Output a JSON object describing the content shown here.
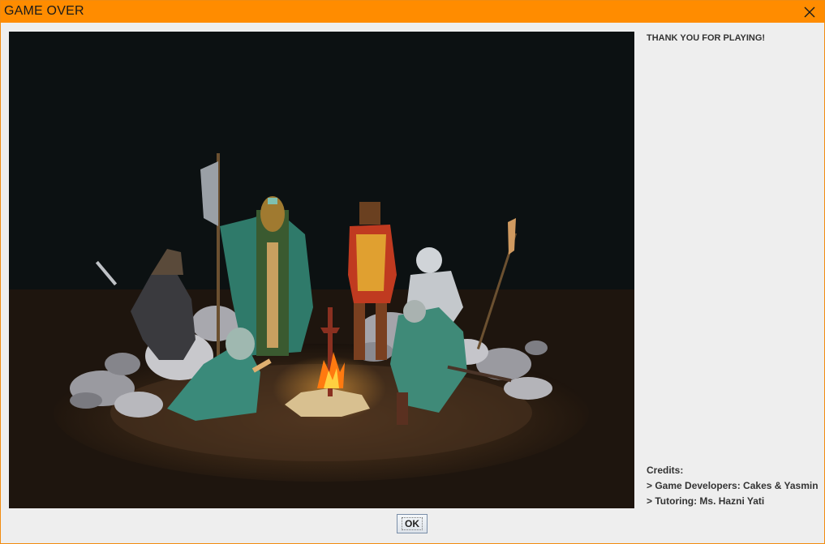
{
  "window": {
    "title": "GAME OVER",
    "accent_color": "#ff8c00"
  },
  "icons": {
    "close": "close-icon"
  },
  "message": {
    "thanks": "THANK YOU FOR PLAYING!"
  },
  "credits": {
    "heading": "Credits:",
    "developers": "> Game Developers: Cakes & Yasmin",
    "tutoring": "> Tutoring: Ms. Hazni Yati"
  },
  "buttons": {
    "ok_label": "OK"
  }
}
